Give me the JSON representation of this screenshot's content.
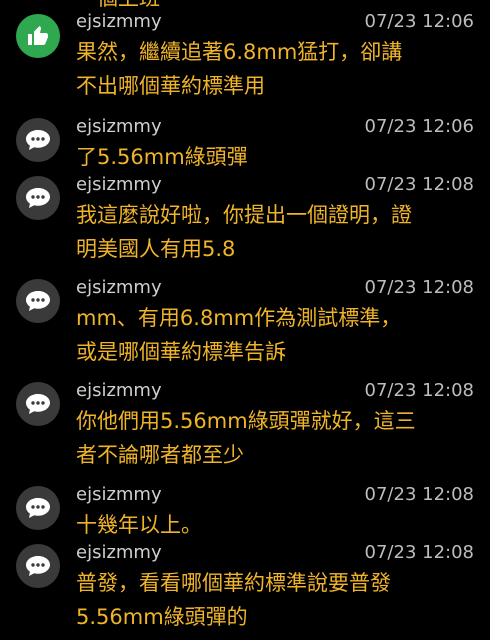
{
  "top_cut_text": "一個上班",
  "comments": [
    {
      "icon": "thumbs-up-icon",
      "user": "ejsizmmy",
      "time": "07/23 12:06",
      "lines": [
        "果然，繼續追著6.8mm猛打，卻講",
        "不出哪個華約標準用"
      ]
    },
    {
      "icon": "chat-bubble-icon",
      "user": "ejsizmmy",
      "time": "07/23 12:06",
      "lines": [
        "了5.56mm綠頭彈"
      ]
    },
    {
      "icon": "chat-bubble-icon",
      "user": "ejsizmmy",
      "time": "07/23 12:08",
      "lines": [
        "我這麼說好啦，你提出一個證明，證",
        "明美國人有用5.8"
      ]
    },
    {
      "icon": "chat-bubble-icon",
      "user": "ejsizmmy",
      "time": "07/23 12:08",
      "lines": [
        "mm、有用6.8mm作為測試標準，",
        "或是哪個華約標準告訴"
      ]
    },
    {
      "icon": "chat-bubble-icon",
      "user": "ejsizmmy",
      "time": "07/23 12:08",
      "lines": [
        "你他們用5.56mm綠頭彈就好，這三",
        "者不論哪者都至少"
      ]
    },
    {
      "icon": "chat-bubble-icon",
      "user": "ejsizmmy",
      "time": "07/23 12:08",
      "lines": [
        "十幾年以上。"
      ]
    },
    {
      "icon": "chat-bubble-icon",
      "user": "ejsizmmy",
      "time": "07/23 12:08",
      "lines": [
        "普發，看看哪個華約標準說要普發",
        "5.56mm綠頭彈的"
      ]
    }
  ],
  "colors": {
    "background": "#000000",
    "comment_text": "#f0b429",
    "like_badge": "#2fa84f",
    "chat_badge": "#3a3a3a"
  }
}
